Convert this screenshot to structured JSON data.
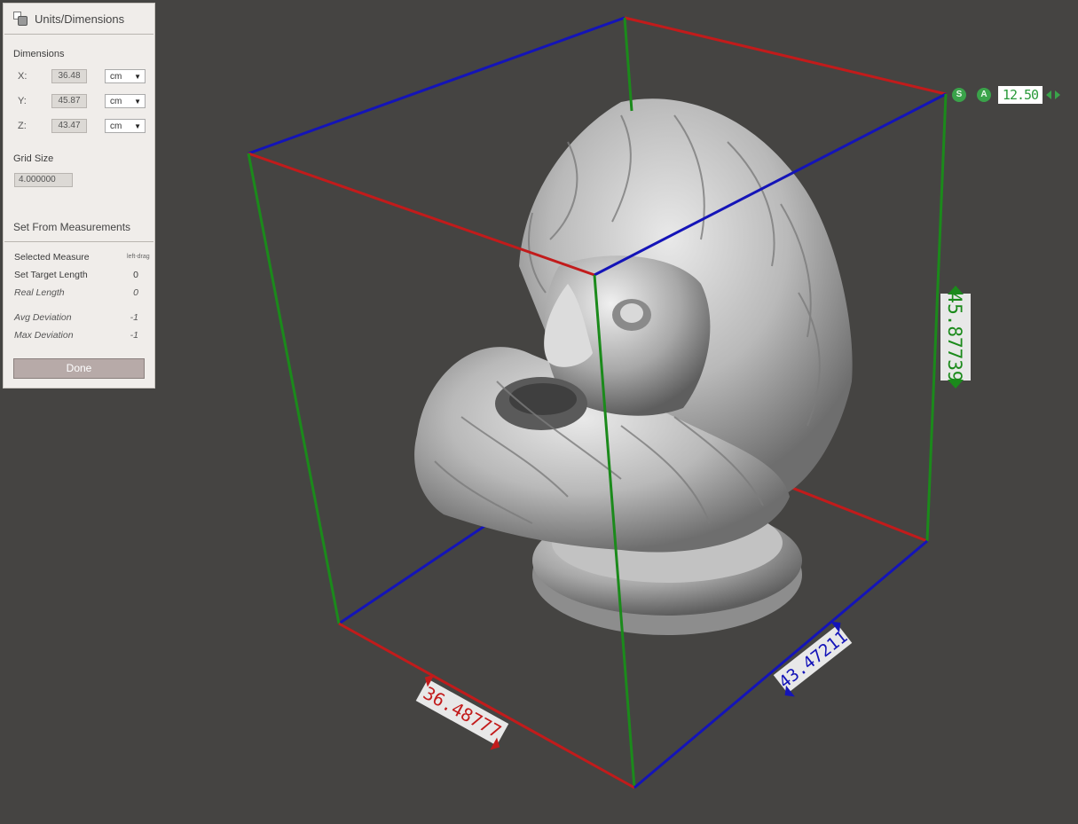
{
  "panel": {
    "title": "Units/Dimensions",
    "dimensions_label": "Dimensions",
    "rows": [
      {
        "axis": "X:",
        "value": "36.48",
        "unit": "cm"
      },
      {
        "axis": "Y:",
        "value": "45.87",
        "unit": "cm"
      },
      {
        "axis": "Z:",
        "value": "43.47",
        "unit": "cm"
      }
    ],
    "grid_size_label": "Grid Size",
    "grid_size_value": "4.000000",
    "set_from_measurements": "Set From Measurements",
    "selected_measure": {
      "label": "Selected Measure",
      "hint": "left-drag"
    },
    "set_target_length": {
      "label": "Set Target Length",
      "value": "0"
    },
    "real_length": {
      "label": "Real Length",
      "value": "0"
    },
    "avg_deviation": {
      "label": "Avg Deviation",
      "value": "-1"
    },
    "max_deviation": {
      "label": "Max Deviation",
      "value": "-1"
    },
    "done_label": "Done"
  },
  "viewport": {
    "snap_button": "S",
    "absolute_button": "A",
    "scale_value": "12.50",
    "measure_x": "36.48777",
    "measure_y": "45.87739",
    "measure_z": "43.47211"
  },
  "colors": {
    "x_axis": "#c21b1b",
    "y_axis": "#1b8a1b",
    "z_axis": "#1414b8",
    "background": "#454442",
    "accent_green": "#3aa34a"
  }
}
